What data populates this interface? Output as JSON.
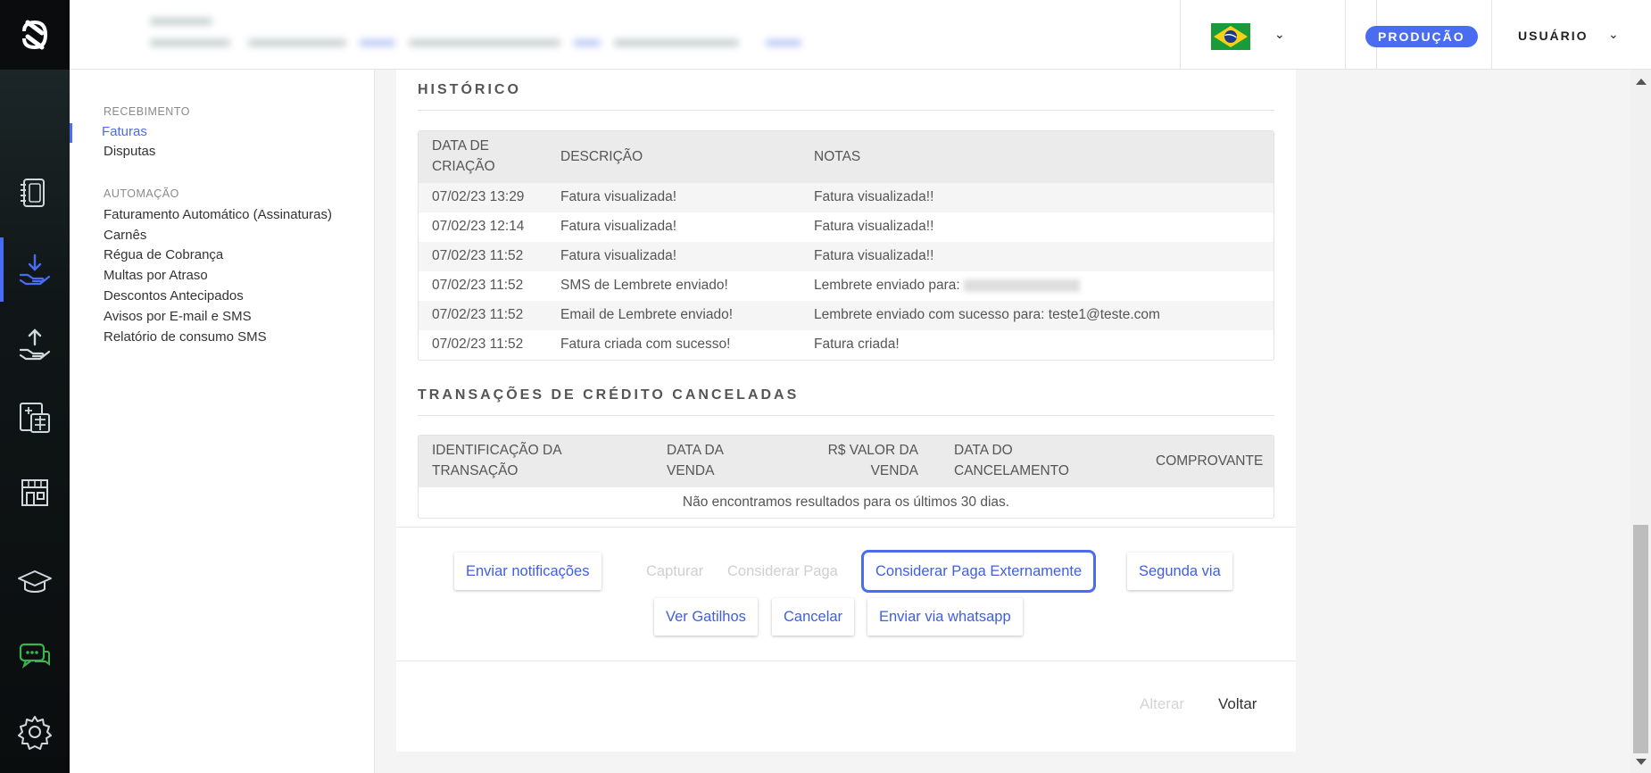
{
  "header": {
    "environment_badge": "PRODUÇÃO",
    "user_menu_label": "USUÁRIO"
  },
  "rail": {
    "icons": [
      "app-logo-icon",
      "invoice-book-icon",
      "receive-money-icon",
      "send-money-icon",
      "calculator-icon",
      "store-icon",
      "graduation-cap-icon",
      "chat-support-icon",
      "settings-gear-icon"
    ],
    "accent_color": "#4a6cf0",
    "chat_icon_color": "#39b54a"
  },
  "sidenav": {
    "sections": [
      {
        "title": "RECEBIMENTO",
        "items": [
          "Faturas",
          "Disputas"
        ]
      },
      {
        "title": "AUTOMAÇÃO",
        "items": [
          "Faturamento Automático (Assinaturas)",
          "Carnês",
          "Régua de Cobrança",
          "Multas por Atraso",
          "Descontos Antecipados",
          "Avisos por E-mail e SMS",
          "Relatório de consumo SMS"
        ]
      }
    ],
    "active_item": "Faturas"
  },
  "history": {
    "title": "HISTÓRICO",
    "columns": [
      "DATA DE\nCRIAÇÃO",
      "DESCRIÇÃO",
      "NOTAS"
    ],
    "rows": [
      {
        "date": "07/02/23 13:29",
        "description": "Fatura visualizada!",
        "notes": "Fatura visualizada!!"
      },
      {
        "date": "07/02/23 12:14",
        "description": "Fatura visualizada!",
        "notes": "Fatura visualizada!!"
      },
      {
        "date": "07/02/23 11:52",
        "description": "Fatura visualizada!",
        "notes": "Fatura visualizada!!"
      },
      {
        "date": "07/02/23 11:52",
        "description": "SMS de Lembrete enviado!",
        "notes": "Lembrete enviado para:"
      },
      {
        "date": "07/02/23 11:52",
        "description": "Email de Lembrete enviado!",
        "notes": "Lembrete enviado com sucesso para: teste1@teste.com"
      },
      {
        "date": "07/02/23 11:52",
        "description": "Fatura criada com sucesso!",
        "notes": "Fatura criada!"
      }
    ]
  },
  "canceled": {
    "title": "TRANSAÇÕES DE CRÉDITO CANCELADAS",
    "columns": [
      "IDENTIFICAÇÃO DA\nTRANSAÇÃO",
      "DATA DA\nVENDA",
      "R$ VALOR DA\nVENDA",
      "DATA DO\nCANCELAMENTO",
      "COMPROVANTE"
    ],
    "empty_message": "Não encontramos resultados para os últimos 30 dias."
  },
  "actions": {
    "send_notifications": "Enviar notificações",
    "capture": "Capturar",
    "mark_paid": "Considerar Paga",
    "mark_paid_externally": "Considerar Paga Externamente",
    "second_copy": "Segunda via",
    "view_triggers": "Ver Gatilhos",
    "cancel": "Cancelar",
    "send_whatsapp": "Enviar via whatsapp"
  },
  "footer": {
    "edit": "Alterar",
    "back": "Voltar"
  }
}
